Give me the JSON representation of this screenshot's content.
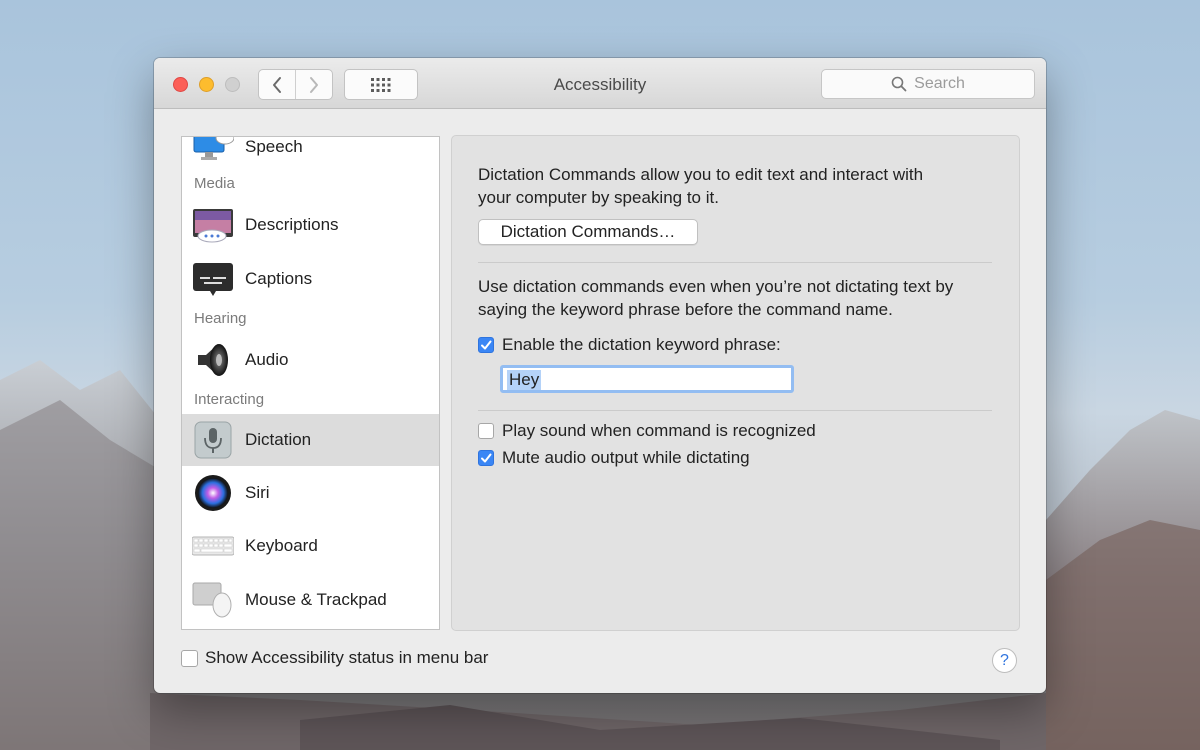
{
  "window": {
    "title": "Accessibility"
  },
  "toolbar": {
    "search_placeholder": "Search",
    "icons": [
      "back-icon",
      "forward-icon",
      "show-all-grid-icon",
      "search-icon"
    ]
  },
  "sidebar": {
    "items": [
      {
        "label": "Speech",
        "icon": "speech-monitor-icon",
        "group": ""
      },
      {
        "label": "Descriptions",
        "icon": "descriptions-icon",
        "group": "Media"
      },
      {
        "label": "Captions",
        "icon": "captions-icon",
        "group": "Media"
      },
      {
        "label": "Audio",
        "icon": "speaker-icon",
        "group": "Hearing"
      },
      {
        "label": "Dictation",
        "icon": "microphone-icon",
        "group": "Interacting",
        "selected": true
      },
      {
        "label": "Siri",
        "icon": "siri-icon",
        "group": "Interacting"
      },
      {
        "label": "Keyboard",
        "icon": "keyboard-icon",
        "group": "Interacting"
      },
      {
        "label": "Mouse & Trackpad",
        "icon": "mouse-trackpad-icon",
        "group": "Interacting"
      }
    ],
    "headers": {
      "media": "Media",
      "hearing": "Hearing",
      "interacting": "Interacting"
    }
  },
  "pane": {
    "intro_line1": "Dictation Commands allow you to edit text and interact with",
    "intro_line2": "your computer by speaking to it.",
    "commands_button": "Dictation Commands…",
    "keyword_desc_line1": "Use dictation commands even when you’re not dictating text by",
    "keyword_desc_line2": "saying the keyword phrase before the command name.",
    "enable_keyword_label": "Enable the dictation keyword phrase:",
    "enable_keyword_checked": true,
    "keyword_value": "Hey",
    "play_sound_label": "Play sound when command is recognized",
    "play_sound_checked": false,
    "mute_audio_label": "Mute audio output while dictating",
    "mute_audio_checked": true
  },
  "footer": {
    "show_status_label": "Show Accessibility status in menu bar",
    "show_status_checked": false,
    "help_label": "?"
  },
  "colors": {
    "accent": "#3a86f5",
    "selection": "#dcdcdc"
  }
}
